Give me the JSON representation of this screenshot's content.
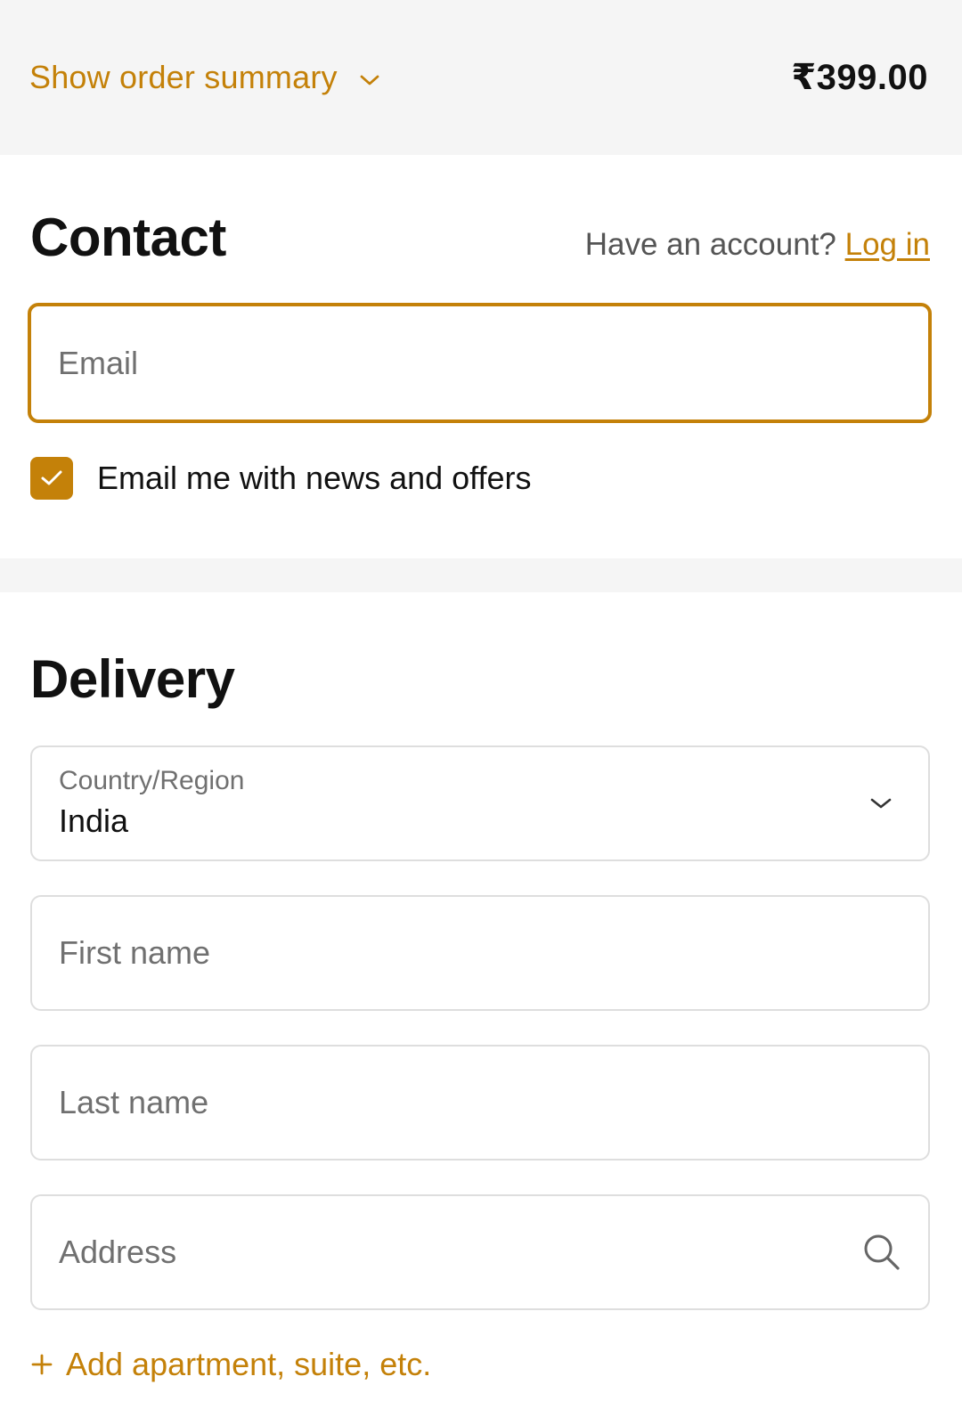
{
  "summary": {
    "toggle_label": "Show order summary",
    "total": "₹399.00"
  },
  "contact": {
    "title": "Contact",
    "account_prompt": "Have an account?",
    "login_label": "Log in",
    "email_placeholder": "Email",
    "newsletter_label": "Email me with news and offers",
    "newsletter_checked": true
  },
  "delivery": {
    "title": "Delivery",
    "country_label": "Country/Region",
    "country_value": "India",
    "first_name_placeholder": "First name",
    "last_name_placeholder": "Last name",
    "address_placeholder": "Address",
    "add_apartment_label": "Add apartment, suite, etc."
  },
  "icons": {
    "summary_toggle": "chevron-down-icon",
    "checkbox": "check-icon",
    "country_select": "chevron-down-icon",
    "address_search": "search-icon",
    "add_apartment": "plus-icon"
  },
  "colors": {
    "accent": "#c48109",
    "text": "#111111",
    "muted": "#707070",
    "background_alt": "#f5f5f5",
    "border": "#dedede"
  }
}
